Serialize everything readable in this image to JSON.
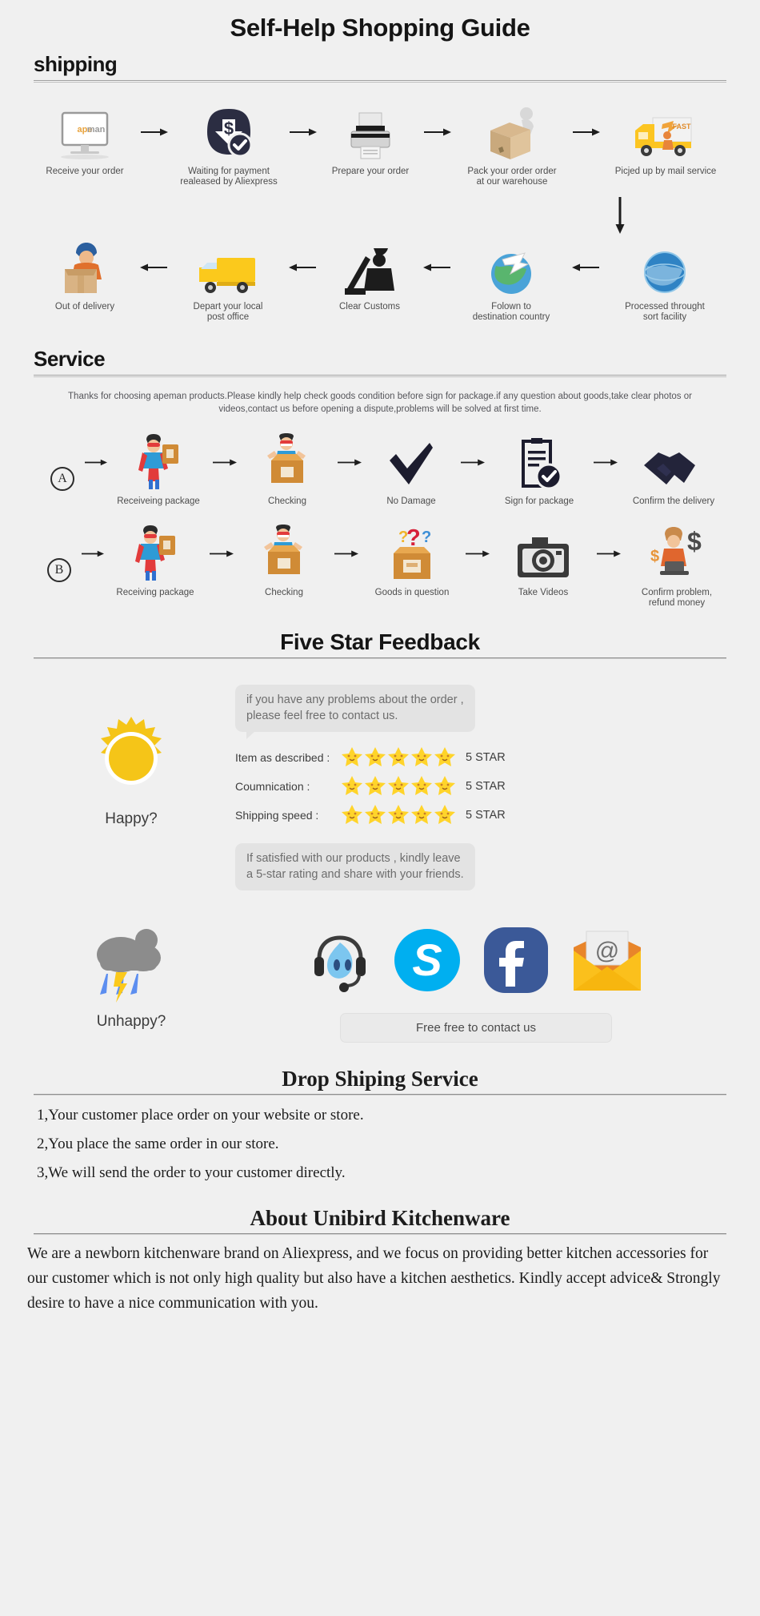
{
  "page": {
    "title": "Self-Help Shopping Guide",
    "bg_color": "#f0f0f0"
  },
  "shipping": {
    "heading": "shipping",
    "row1": [
      {
        "label": "Receive your order",
        "icon": "monitor-apeman-icon"
      },
      {
        "label": "Waiting for payment\nrealeased by Aliexpress",
        "icon": "payment-dollar-icon"
      },
      {
        "label": "Prepare your order",
        "icon": "printer-icon"
      },
      {
        "label": "Pack your order order\nat our warehouse",
        "icon": "packing-box-icon"
      },
      {
        "label": "Picjed up by mail service",
        "icon": "fast-delivery-truck-icon"
      }
    ],
    "row2": [
      {
        "label": "Out of delivery",
        "icon": "courier-delivery-icon"
      },
      {
        "label": "Depart your local\npost office",
        "icon": "yellow-truck-icon"
      },
      {
        "label": "Clear Customs",
        "icon": "customs-officer-icon"
      },
      {
        "label": "Folown to\ndestination country",
        "icon": "globe-airplane-icon"
      },
      {
        "label": "Processed throught\nsort facility",
        "icon": "blue-globe-icon"
      }
    ]
  },
  "service": {
    "heading": "Service",
    "note": "Thanks for choosing apeman products.Please kindly help check goods condition before sign for package.if any question about goods,take clear photos or videos,contact us before opening a dispute,problems will be solved at first time.",
    "row_a": {
      "badge": "A",
      "steps": [
        {
          "label": "Receiveing package",
          "icon": "hero-with-package-icon"
        },
        {
          "label": "Checking",
          "icon": "hero-opening-box-icon"
        },
        {
          "label": "No Damage",
          "icon": "check-mark-icon"
        },
        {
          "label": "Sign for package",
          "icon": "clipboard-check-icon"
        },
        {
          "label": "Confirm the delivery",
          "icon": "handshake-icon"
        }
      ]
    },
    "row_b": {
      "badge": "B",
      "steps": [
        {
          "label": "Receiving package",
          "icon": "hero-with-package-icon"
        },
        {
          "label": "Checking",
          "icon": "hero-opening-box-icon"
        },
        {
          "label": "Goods in question",
          "icon": "question-box-icon"
        },
        {
          "label": "Take Videos",
          "icon": "camera-icon"
        },
        {
          "label": "Confirm problem,\nrefund money",
          "icon": "refund-agent-icon"
        }
      ]
    }
  },
  "feedback": {
    "heading": "Five Star Feedback",
    "happy_label": "Happy?",
    "unhappy_label": "Unhappy?",
    "bubble_top": "if you have any problems about the order ,\nplease feel free to contact us.",
    "bubble_bottom": "If satisfied with our products ,  kindly leave\na 5-star rating and share with your friends.",
    "ratings": [
      {
        "label": "Item as described :",
        "stars": 5,
        "value": "5 STAR"
      },
      {
        "label": "Coumnication :",
        "stars": 5,
        "value": "5 STAR"
      },
      {
        "label": "Shipping speed :",
        "stars": 5,
        "value": "5 STAR"
      }
    ],
    "socials": [
      {
        "name": "alitalk-icon",
        "color": "#5bb4e5"
      },
      {
        "name": "skype-icon",
        "color": "#00aff0"
      },
      {
        "name": "facebook-icon",
        "color": "#3b5998"
      },
      {
        "name": "email-icon",
        "color": "#f5b820"
      }
    ],
    "contact_button": "Free free to contact us",
    "star_color": "#ffd42a",
    "sun_color": "#f5c518",
    "cloud_color": "#8c8c8c"
  },
  "dropship": {
    "heading": "Drop Shiping Service",
    "items": [
      "1,Your customer place order on your website or store.",
      "2,You place the same order in our store.",
      "3,We will send the order to your customer directly."
    ]
  },
  "about": {
    "heading": "About Unibird Kitchenware",
    "body": "   We are a newborn kitchenware brand on Aliexpress, and we focus on providing better kitchen accessories for our customer which is not only high quality but also have a kitchen aesthetics. Kindly accept advice& Strongly desire to have a nice communication with you."
  }
}
